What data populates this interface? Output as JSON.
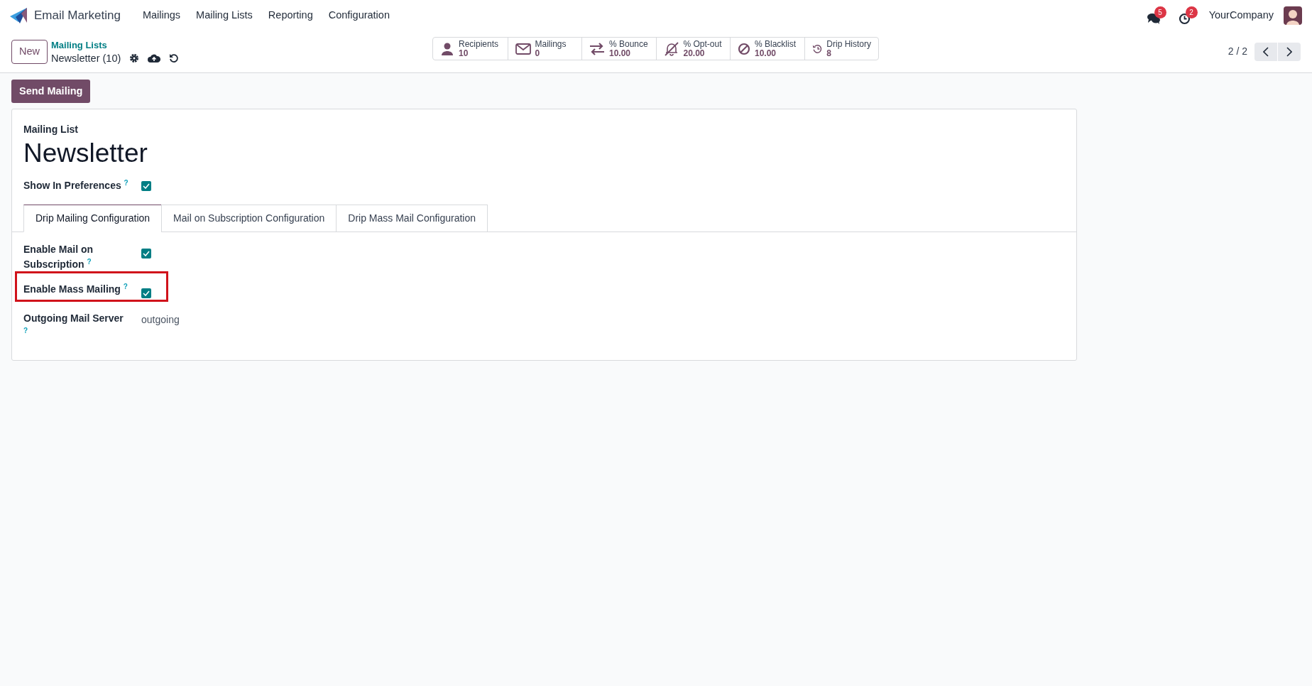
{
  "navbar": {
    "app_name": "Email Marketing",
    "menu": [
      "Mailings",
      "Mailing Lists",
      "Reporting",
      "Configuration"
    ],
    "messages_count": "5",
    "activities_count": "2",
    "company": "YourCompany"
  },
  "control_panel": {
    "new_button": "New",
    "breadcrumb": "Mailing Lists",
    "record_title": "Newsletter (10)",
    "pager": "2 / 2"
  },
  "stat_buttons": [
    {
      "kind": "person",
      "label": "Recipients",
      "value": "10"
    },
    {
      "kind": "envelope",
      "label": "Mailings",
      "value": "0"
    },
    {
      "kind": "arrows",
      "label": "% Bounce",
      "value": "10.00"
    },
    {
      "kind": "bell-off",
      "label": "% Opt-out",
      "value": "20.00"
    },
    {
      "kind": "ban",
      "label": "% Blacklist",
      "value": "10.00"
    },
    {
      "kind": "history",
      "label": "Drip History",
      "value": "8"
    }
  ],
  "action_button": "Send Mailing",
  "form": {
    "caption": "Mailing List",
    "name": "Newsletter",
    "show_in_preferences": {
      "label": "Show In Preferences",
      "help": "?",
      "checked": true
    },
    "tabs": [
      {
        "label": "Drip Mailing Configuration",
        "selected": true
      },
      {
        "label": "Mail on Subscription Configuration",
        "selected": false
      },
      {
        "label": "Drip Mass Mail Configuration",
        "selected": false
      }
    ],
    "fields": [
      {
        "kind": "checkbox",
        "label": "Enable Mail on Subscription",
        "help": "?",
        "checked": true,
        "highlighted": false
      },
      {
        "kind": "checkbox",
        "label": "Enable Mass Mailing",
        "help": "?",
        "checked": true,
        "highlighted": true
      },
      {
        "kind": "text",
        "label": "Outgoing Mail Server",
        "help": "?",
        "value": "outgoing",
        "highlighted": false
      }
    ]
  }
}
